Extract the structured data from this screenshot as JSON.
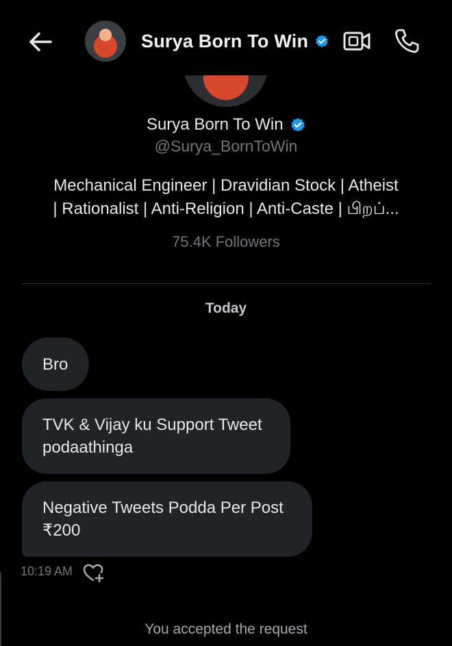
{
  "header": {
    "title": "Surya Born To Win",
    "back_icon": "arrow-left-icon",
    "video_icon": "video-camera-icon",
    "call_icon": "phone-icon",
    "verified_icon": "verified-badge-icon",
    "accent": "#1d9bf0"
  },
  "profile": {
    "name": "Surya Born To Win",
    "handle": "@Surya_BornToWin",
    "bio_line1": "Mechanical Engineer | Dravidian Stock | Atheist",
    "bio_line2": "| Rationalist | Anti-Religion | Anti-Caste | பிறப்...",
    "followers": "75.4K Followers"
  },
  "conversation": {
    "date_label": "Today",
    "messages": [
      {
        "text": "Bro"
      },
      {
        "text_line1": "TVK & Vijay ku Support Tweet",
        "text_line2": "podaathinga"
      },
      {
        "text_line1": "Negative Tweets Podda Per Post",
        "text_line2": "₹200"
      }
    ],
    "time": "10:19 AM",
    "react_icon": "heart-plus-icon",
    "footer": "You accepted the request"
  }
}
